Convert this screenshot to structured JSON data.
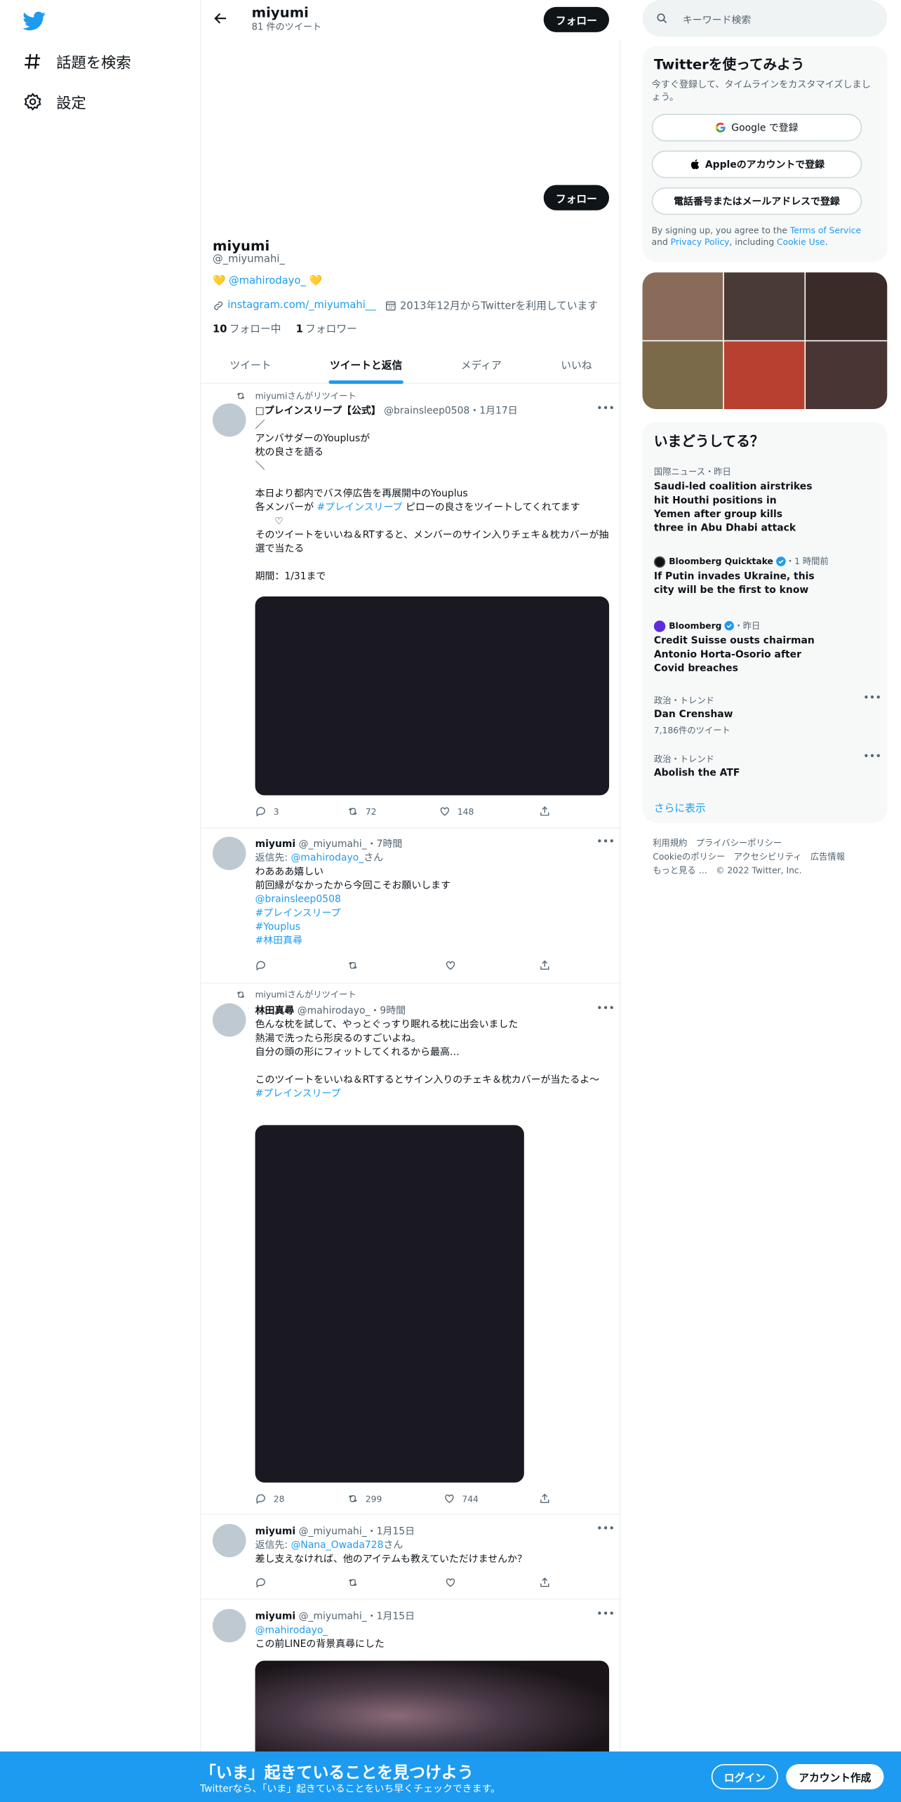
{
  "nav": {
    "explore": "話題を検索",
    "settings": "設定"
  },
  "header": {
    "name": "miyumi",
    "tweet_count": "81 件のツイート",
    "follow": "フォロー"
  },
  "profile": {
    "follow": "フォロー",
    "name": "miyumi",
    "handle": "@_miyumahi_",
    "bio_prefix": "💛 ",
    "bio_link": "@mahirodayo_",
    "bio_suffix": " 💛",
    "website": "instagram.com/_miyumahi__",
    "joined": "2013年12月からTwitterを利用しています",
    "following_count": "10",
    "following_label": "フォロー中",
    "followers_count": "1",
    "followers_label": "フォロワー"
  },
  "tabs": [
    "ツイート",
    "ツイートと返信",
    "メディア",
    "いいね"
  ],
  "tweets": [
    {
      "rt_label": "miyumiさんがリツイート",
      "name": "□プレインスリープ【公式】",
      "meta": "@brainsleep0508・1月17日",
      "body_a": "／\nアンバサダーのYouplusが\n枕の良さを語る\n＼\n\n本日より都内でバス停広告を再展開中のYouplus\n各メンバーが ",
      "hashtag": "#プレインスリープ",
      "body_b": " ピローの良さをツイートしてくれてます\n　　♡\nそのツイートをいいね＆RTすると、メンバーのサイン入りチェキ＆枕カバーが抽選で当たる\n\n期間：1/31まで",
      "reply": "3",
      "retweet": "72",
      "like": "148"
    },
    {
      "name": "miyumi",
      "meta": "@_miyumahi_・7時間",
      "reply_to_label": "返信先: ",
      "reply_to": "@mahirodayo_",
      "reply_to_suffix": "さん",
      "body": "わあああ嬉しい\n前回縁がなかったから今回こそお願いします",
      "links": [
        "@brainsleep0508",
        "#プレインスリープ",
        "#Youplus",
        "#林田真尋"
      ]
    },
    {
      "rt_label": "miyumiさんがリツイート",
      "name": "林田真尋",
      "meta": "@mahirodayo_・9時間",
      "body": "色んな枕を試して、やっとぐっすり眠れる枕に出会いました\n熱湯で洗ったら形戻るのすごいよね。\n自分の頭の形にフィットしてくれるから最高…\n\nこのツイートをいいね＆RTするとサイン入りのチェキ＆枕カバーが当たるよ〜",
      "hashtag": "#プレインスリープ",
      "reply": "28",
      "retweet": "299",
      "like": "744"
    },
    {
      "name": "miyumi",
      "meta": "@_miyumahi_・1月15日",
      "reply_to_label": "返信先: ",
      "reply_to": "@Nana_Owada728",
      "reply_to_suffix": "さん",
      "body": "差し支えなければ、他のアイテムも教えていただけませんか？"
    },
    {
      "name": "miyumi",
      "meta": "@_miyumahi_・1月15日",
      "mention": "@mahirodayo_",
      "body": "この前LINEの背景真尋にした"
    }
  ],
  "sidebar": {
    "search_placeholder": "キーワード検索",
    "signup": {
      "title": "Twitterを使ってみよう",
      "sub": "今すぐ登録して、タイムラインをカスタマイズしましょう。",
      "google": "Google で登録",
      "apple": "Appleのアカウントで登録",
      "phone": "電話番号またはメールアドレスで登録",
      "tos_a": "By signing up, you agree to the ",
      "tos_link1": "Terms of Service",
      "tos_b": " and ",
      "tos_link2": "Privacy Policy",
      "tos_c": ", including ",
      "tos_link3": "Cookie Use",
      "tos_d": "."
    },
    "media_colors": [
      "#8a6a58",
      "#4a3a35",
      "#3a2a28",
      "#7a6a4a",
      "#b84030",
      "#4a3535"
    ],
    "trends_title": "いまどうしてる？",
    "trends": [
      {
        "meta": "国際ニュース・昨日",
        "title": "Saudi-led coalition airstrikes hit Houthi positions in Yemen after group kills three in Abu Dhabi attack"
      },
      {
        "source": "Bloomberg Quicktake",
        "time": "・1 時間前",
        "title": "If Putin invades Ukraine, this city will be the first to know"
      },
      {
        "source": "Bloomberg",
        "time": "・昨日",
        "title": "Credit Suisse ousts chairman Antonio Horta-Osorio after Covid breaches"
      },
      {
        "meta": "政治・トレンド",
        "title": "Dan Crenshaw",
        "count": "7,186件のツイート"
      },
      {
        "meta": "政治・トレンド",
        "title": "Abolish the ATF"
      }
    ],
    "show_more": "さらに表示",
    "footer": {
      "l1": "利用規約　プライバシーポリシー",
      "l2": "Cookieのポリシー　アクセシビリティ　広告情報",
      "l3": "もっと見る …　© 2022 Twitter, Inc."
    }
  },
  "bottom_bar": {
    "title": "「いま」起きていることを見つけよう",
    "sub": "Twitterなら、「いま」起きていることをいち早くチェックできます。",
    "login": "ログイン",
    "signup": "アカウント作成"
  }
}
